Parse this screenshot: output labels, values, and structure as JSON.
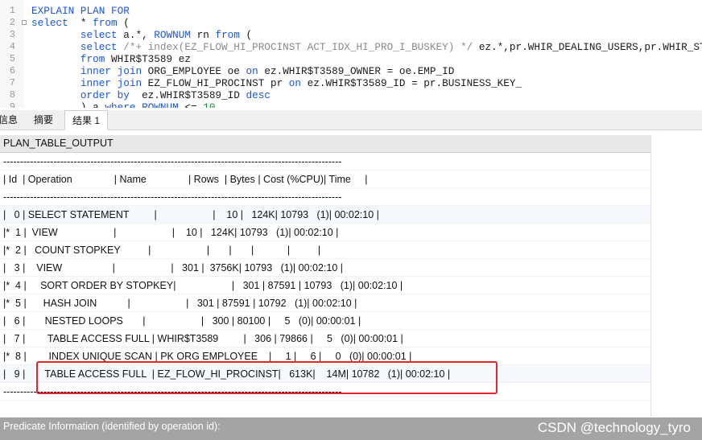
{
  "editor": {
    "lines": [
      {
        "n": "1",
        "segs": [
          [
            "kw",
            "EXPLAIN PLAN FOR"
          ]
        ]
      },
      {
        "n": "2",
        "segs": [
          [
            "kw",
            "select"
          ],
          [
            "",
            "  * "
          ],
          [
            "kw",
            "from"
          ],
          [
            "",
            " ("
          ]
        ]
      },
      {
        "n": "3",
        "segs": [
          [
            "",
            "        "
          ],
          [
            "kw",
            "select"
          ],
          [
            "",
            " a.*, "
          ],
          [
            "kw",
            "ROWNUM"
          ],
          [
            "",
            " rn "
          ],
          [
            "kw",
            "from"
          ],
          [
            "",
            " ("
          ]
        ]
      },
      {
        "n": "4",
        "segs": [
          [
            "",
            "        "
          ],
          [
            "kw",
            "select"
          ],
          [
            "cm",
            " /*+ index(EZ_FLOW_HI_PROCINST ACT_IDX_HI_PRO_I_BUSKEY) */"
          ],
          [
            "",
            " ez.*,pr.WHIR_DEALING_USERS,pr.WHIR_STATUS"
          ]
        ]
      },
      {
        "n": "5",
        "segs": [
          [
            "",
            "        "
          ],
          [
            "kw",
            "from"
          ],
          [
            "",
            " WHIR$T3589 ez"
          ]
        ]
      },
      {
        "n": "6",
        "segs": [
          [
            "",
            "        "
          ],
          [
            "kw",
            "inner join"
          ],
          [
            "",
            " ORG_EMPLOYEE oe "
          ],
          [
            "kw",
            "on"
          ],
          [
            "",
            " ez.WHIR$T3589_OWNER = oe.EMP_ID"
          ]
        ]
      },
      {
        "n": "7",
        "segs": [
          [
            "",
            "        "
          ],
          [
            "kw",
            "inner join"
          ],
          [
            "",
            " EZ_FLOW_HI_PROCINST pr "
          ],
          [
            "kw",
            "on"
          ],
          [
            "",
            " ez.WHIR$T3589_ID = pr.BUSINESS_KEY_"
          ]
        ]
      },
      {
        "n": "8",
        "segs": [
          [
            "",
            "        "
          ],
          [
            "kw",
            "order by"
          ],
          [
            "",
            "  ez.WHIR$T3589_ID "
          ],
          [
            "kw",
            "desc"
          ]
        ]
      },
      {
        "n": "9",
        "segs": [
          [
            "",
            "        ) a "
          ],
          [
            "kw",
            "where"
          ],
          [
            "",
            " "
          ],
          [
            "kw",
            "ROWNUM"
          ],
          [
            "",
            " <= "
          ],
          [
            "nm",
            "10"
          ]
        ]
      }
    ]
  },
  "tabs": [
    {
      "label": "信息",
      "active": false
    },
    {
      "label": "摘要",
      "active": false
    },
    {
      "label": "结果 1",
      "active": true
    }
  ],
  "grid": {
    "column_header": "PLAN_TABLE_OUTPUT",
    "rows": [
      "-----------------------------------------------------------------------------------------------------",
      "| Id  | Operation               | Name               | Rows  | Bytes | Cost (%CPU)| Time     |",
      "-----------------------------------------------------------------------------------------------------",
      "|   0 | SELECT STATEMENT         |                    |    10 |   124K| 10793   (1)| 00:02:10 |",
      "|*  1 |  VIEW                    |                    |    10 |   124K| 10793   (1)| 00:02:10 |",
      "|*  2 |   COUNT STOPKEY          |                    |       |       |            |          |",
      "|   3 |    VIEW                  |                    |   301 |  3756K| 10793   (1)| 00:02:10 |",
      "|*  4 |     SORT ORDER BY STOPKEY|                    |   301 | 87591 | 10793   (1)| 00:02:10 |",
      "|*  5 |      HASH JOIN           |                    |   301 | 87591 | 10792   (1)| 00:02:10 |",
      "|   6 |       NESTED LOOPS       |                    |   300 | 80100 |     5   (0)| 00:00:01 |",
      "|   7 |        TABLE ACCESS FULL | WHIR$T3589         |   306 | 79866 |     5   (0)| 00:00:01 |",
      "|*  8 |        INDEX UNIQUE SCAN | PK ORG EMPLOYEE    |     1 |     6 |     0   (0)| 00:00:01 |",
      "|   9 |       TABLE ACCESS FULL  | EZ_FLOW_HI_PROCINST|   613K|    14M| 10782   (1)| 00:02:10 |",
      "-----------------------------------------------------------------------------------------------------",
      ""
    ]
  },
  "footer": {
    "text": "Predicate Information (identified by operation id):",
    "watermark": "CSDN @technology_tyro"
  },
  "colors": {
    "keyword": "#1a55d8",
    "comment": "#8a8a8a",
    "number": "#0b8f3a",
    "highlight_box": "#e3242b"
  }
}
